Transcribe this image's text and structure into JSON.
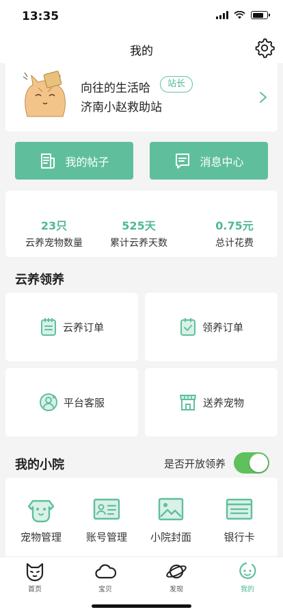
{
  "status_bar": {
    "time": "13:35"
  },
  "nav": {
    "title": "我的"
  },
  "profile": {
    "name": "向往的生活哈",
    "role": "站长",
    "station": "济南小赵救助站"
  },
  "actions": {
    "my_posts": "我的帖子",
    "message_center": "消息中心"
  },
  "stats": [
    {
      "value": "23只",
      "label": "云养宠物数量"
    },
    {
      "value": "525天",
      "label": "累计云养天数"
    },
    {
      "value": "0.75元",
      "label": "总计花费"
    }
  ],
  "cloud_adopt": {
    "title": "云养领养",
    "items": [
      "云养订单",
      "领养订单",
      "平台客服",
      "送养宠物"
    ]
  },
  "my_yard": {
    "title": "我的小院",
    "toggle_label": "是否开放领养",
    "toggle_on": true,
    "items": [
      "宠物管理",
      "账号管理",
      "小院封面",
      "银行卡"
    ]
  },
  "tabs": [
    {
      "label": "首页",
      "icon": "cat-face-icon"
    },
    {
      "label": "宝贝",
      "icon": "cloud-icon"
    },
    {
      "label": "发现",
      "icon": "planet-icon"
    },
    {
      "label": "我的",
      "icon": "profile-icon",
      "active": true
    }
  ],
  "colors": {
    "accent": "#5fbf9d",
    "accent_text": "#4fb896",
    "toggle": "#5fc05e"
  }
}
